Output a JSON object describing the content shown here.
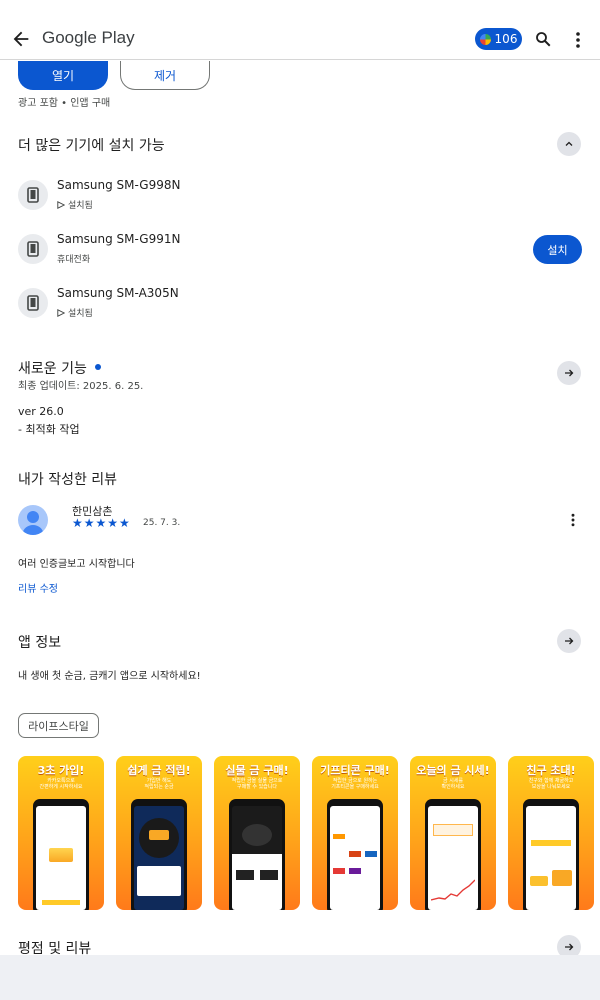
{
  "header": {
    "title": "Google Play",
    "points": "106"
  },
  "actions": {
    "open_label": "열기",
    "remove_label": "제거",
    "ads_note": "광고 포함 • 인앱 구매"
  },
  "devices": {
    "title": "더 많은 기기에 설치 가능",
    "items": [
      {
        "name": "Samsung SM-G998N",
        "status": "설치됨"
      },
      {
        "name": "Samsung SM-G991N",
        "status": "휴대전화"
      },
      {
        "name": "Samsung SM-A305N",
        "status": "설치됨"
      }
    ],
    "install_label": "설치"
  },
  "whats_new": {
    "title": "새로운 기능",
    "updated": "최종 업데이트: 2025. 6. 25.",
    "version": "ver 26.0",
    "note": "- 최적화 작업"
  },
  "my_review": {
    "title": "내가 작성한 리뷰",
    "reviewer": "한민삼촌",
    "rating": 5,
    "stars": "★★★★★",
    "date": "25. 7. 3.",
    "text": "여러 인증글보고 시작합니다",
    "edit_label": "리뷰 수정"
  },
  "app_info": {
    "title": "앱 정보",
    "description": "내 생애 첫 순금, 금캐기 앱으로 시작하세요!",
    "category": "라이프스타일"
  },
  "screenshots": [
    {
      "caption": "3초 가입!",
      "sub": "카카오톡으로\n간편하게 시작하세요"
    },
    {
      "caption": "쉽게 금 적립!",
      "sub": "가입만 해도\n적립되는 순금"
    },
    {
      "caption": "실물 금 구매!",
      "sub": "적립한 금을 실물 금으로\n구매할 수 있습니다"
    },
    {
      "caption": "기프티콘 구매!",
      "sub": "적립한 금으로 원하는\n기프티콘을 구매하세요"
    },
    {
      "caption": "오늘의 금 시세!",
      "sub": "금 시세를\n확인하세요"
    },
    {
      "caption": "친구 초대!",
      "sub": "친구와 함께 채굴하고\n보상을 나눠보세요"
    }
  ],
  "ratings": {
    "title": "평점 및 리뷰"
  },
  "colors": {
    "accent": "#0b57d0",
    "screenshot_bg": "#ffa31a"
  }
}
